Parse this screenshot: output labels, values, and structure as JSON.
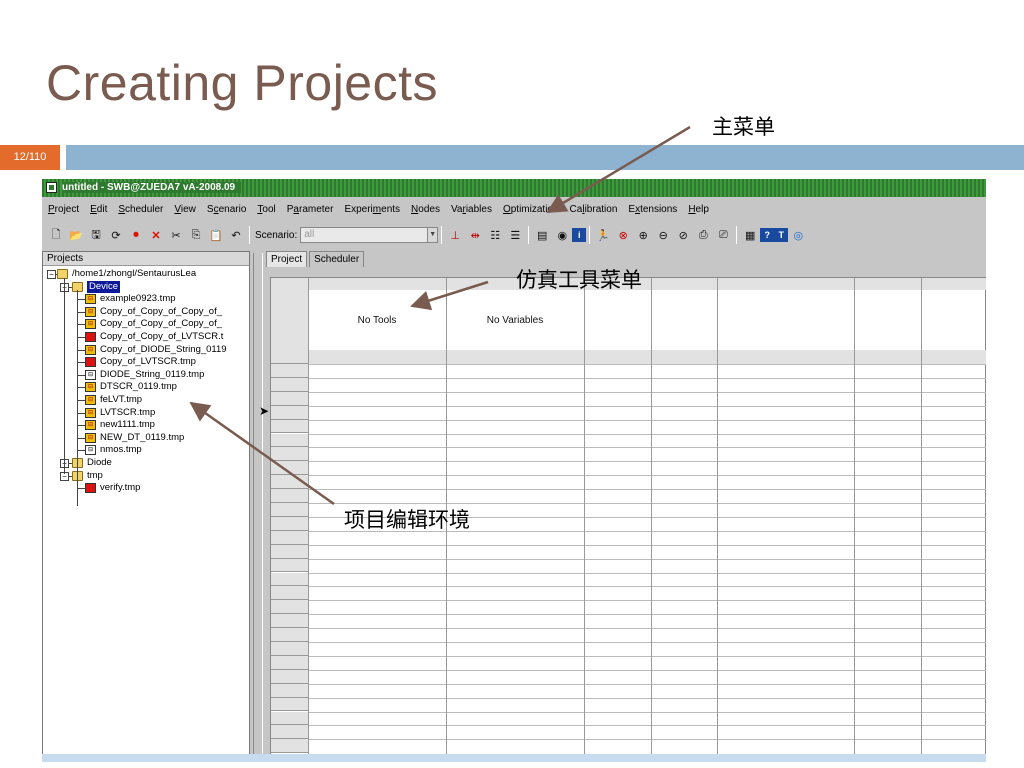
{
  "slide": {
    "title": "Creating Projects",
    "page_number": "12/110"
  },
  "annotations": {
    "main_menu": "主菜单",
    "tool_menu": "仿真工具菜单",
    "project_env": "项目编辑环境"
  },
  "window": {
    "title": "untitled - SWB@ZUEDA7 vA-2008.09"
  },
  "menubar": [
    {
      "pre": "",
      "u": "P",
      "post": "roject"
    },
    {
      "pre": "",
      "u": "E",
      "post": "dit"
    },
    {
      "pre": "",
      "u": "S",
      "post": "cheduler"
    },
    {
      "pre": "",
      "u": "V",
      "post": "iew"
    },
    {
      "pre": "S",
      "u": "c",
      "post": "enario"
    },
    {
      "pre": "",
      "u": "T",
      "post": "ool"
    },
    {
      "pre": "P",
      "u": "a",
      "post": "rameter"
    },
    {
      "pre": "Experi",
      "u": "m",
      "post": "ents"
    },
    {
      "pre": "",
      "u": "N",
      "post": "odes"
    },
    {
      "pre": "Va",
      "u": "r",
      "post": "iables"
    },
    {
      "pre": "",
      "u": "O",
      "post": "ptimization"
    },
    {
      "pre": "Ca",
      "u": "l",
      "post": "ibration"
    },
    {
      "pre": "E",
      "u": "x",
      "post": "tensions"
    },
    {
      "pre": "",
      "u": "H",
      "post": "elp"
    }
  ],
  "toolbar": {
    "scenario_label": "Scenario:",
    "scenario_value": "all"
  },
  "projects_panel": {
    "header": "Projects",
    "tree": [
      {
        "label": "/home1/zhongl/SentaurusLea",
        "icon": "folder",
        "level": 0,
        "expander": "−"
      },
      {
        "label": "Device",
        "icon": "folder",
        "level": 1,
        "expander": "−",
        "selected": true
      },
      {
        "label": "example0923.tmp",
        "icon": "file",
        "level": 2
      },
      {
        "label": "Copy_of_Copy_of_Copy_of_",
        "icon": "file",
        "level": 2
      },
      {
        "label": "Copy_of_Copy_of_Copy_of_",
        "icon": "file",
        "level": 2
      },
      {
        "label": "Copy_of_Copy_of_LVTSCR.t",
        "icon": "file-red",
        "level": 2
      },
      {
        "label": "Copy_of_DIODE_String_0119",
        "icon": "file",
        "level": 2
      },
      {
        "label": "Copy_of_LVTSCR.tmp",
        "icon": "file-red",
        "level": 2
      },
      {
        "label": "DIODE_String_0119.tmp",
        "icon": "file-white",
        "level": 2
      },
      {
        "label": "DTSCR_0119.tmp",
        "icon": "file",
        "level": 2
      },
      {
        "label": "feLVT.tmp",
        "icon": "file",
        "level": 2
      },
      {
        "label": "LVTSCR.tmp",
        "icon": "file",
        "level": 2
      },
      {
        "label": "new1111.tmp",
        "icon": "file",
        "level": 2
      },
      {
        "label": "NEW_DT_0119.tmp",
        "icon": "file",
        "level": 2
      },
      {
        "label": "nmos.tmp",
        "icon": "file-white",
        "level": 2
      },
      {
        "label": "Diode",
        "icon": "folder",
        "level": 1,
        "expander": "+"
      },
      {
        "label": "tmp",
        "icon": "folder",
        "level": 1,
        "expander": "−"
      },
      {
        "label": "verify.tmp",
        "icon": "file-red",
        "level": 2
      }
    ]
  },
  "right_panel": {
    "tabs": [
      "Project",
      "Scheduler"
    ],
    "no_tools": "No Tools",
    "no_variables": "No Variables"
  }
}
